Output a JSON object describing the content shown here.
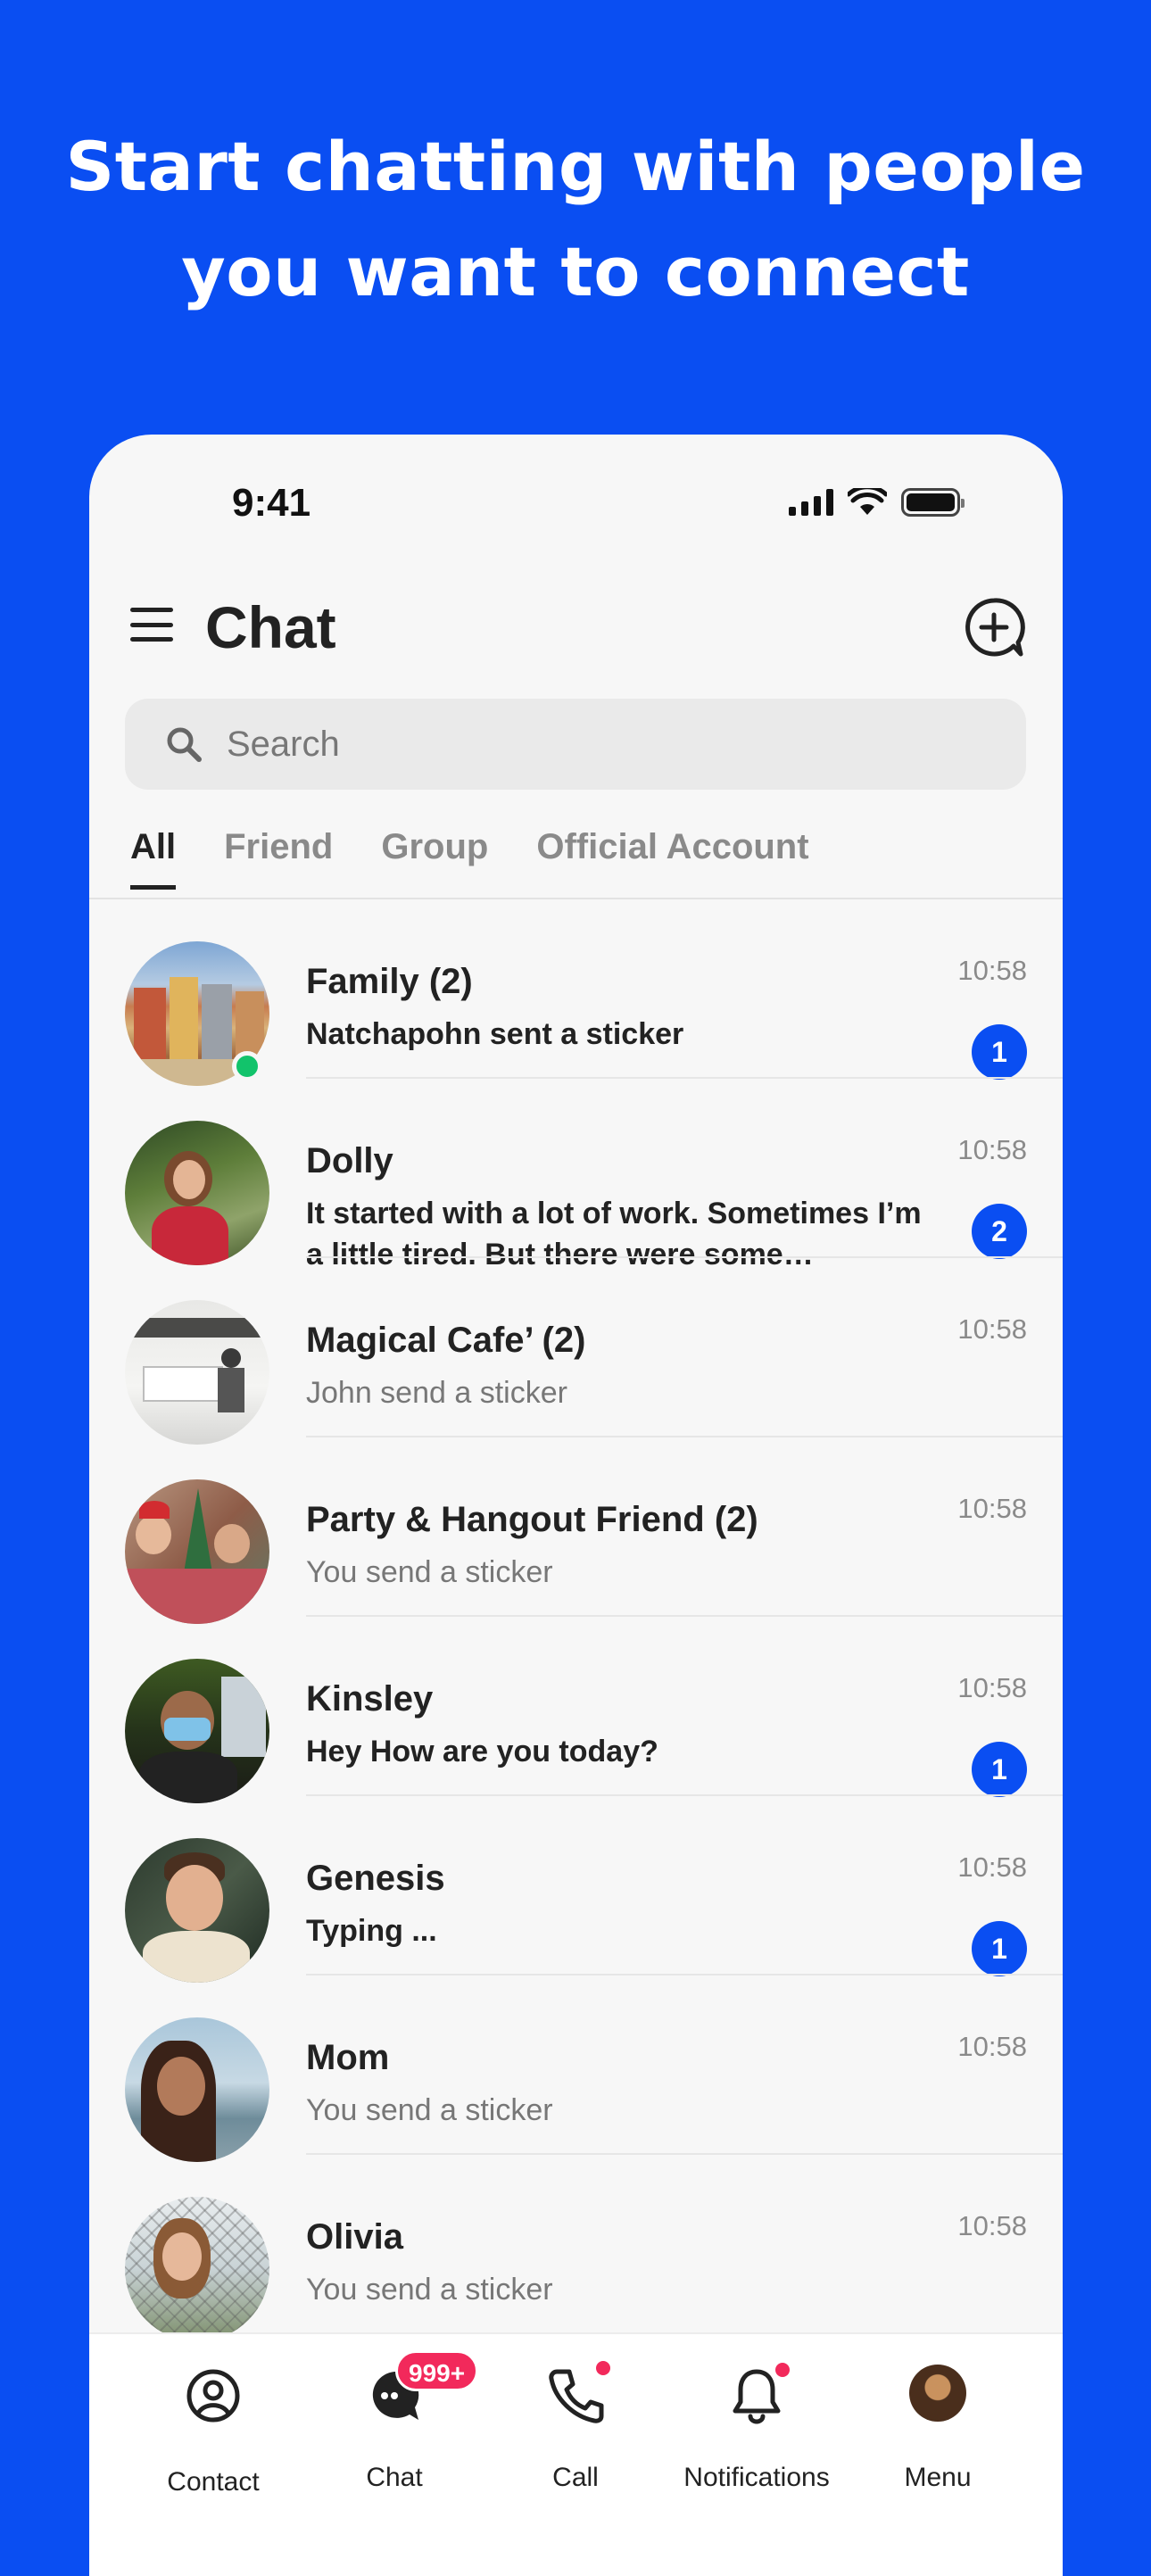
{
  "headline": {
    "line1": "Start chatting with people",
    "line2": "you want to connect"
  },
  "status_bar": {
    "time": "9:41"
  },
  "header": {
    "title": "Chat"
  },
  "search": {
    "placeholder": "Search"
  },
  "tabs": [
    {
      "label": "All",
      "active": true
    },
    {
      "label": "Friend",
      "active": false
    },
    {
      "label": "Group",
      "active": false
    },
    {
      "label": "Official Account",
      "active": false
    }
  ],
  "chats": [
    {
      "name": "Family (2)",
      "message": "Natchapohn sent a sticker",
      "time": "10:58",
      "unread": "1",
      "online": true
    },
    {
      "name": "Dolly",
      "message": "It started with a lot of work. Sometimes I’m a little tired. But there were some…",
      "time": "10:58",
      "unread": "2"
    },
    {
      "name": "Magical Cafe’ (2)",
      "message": "John send a sticker",
      "time": "10:58"
    },
    {
      "name": "Party & Hangout Friend (2)",
      "message": "You send a sticker",
      "time": "10:58"
    },
    {
      "name": "Kinsley",
      "message": "Hey How are you today?",
      "time": "10:58",
      "unread": "1"
    },
    {
      "name": "Genesis",
      "message": "Typing ...",
      "time": "10:58",
      "unread": "1"
    },
    {
      "name": "Mom",
      "message": "You send a sticker",
      "time": "10:58"
    },
    {
      "name": "Olivia",
      "message": "You send a sticker",
      "time": "10:58"
    }
  ],
  "bottom_nav": {
    "contact": "Contact",
    "chat": "Chat",
    "chat_badge": "999+",
    "call": "Call",
    "notifications": "Notifications",
    "menu": "Menu"
  },
  "colors": {
    "brand_blue": "#0A4EF2",
    "badge_pink": "#F2295B",
    "online_green": "#12C36B"
  }
}
